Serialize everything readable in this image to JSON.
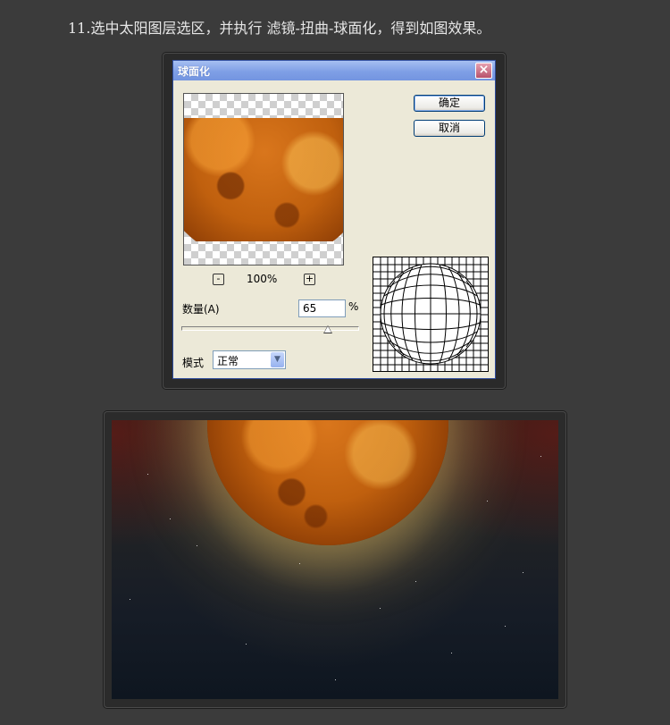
{
  "instruction": "11.选中太阳图层选区，并执行 滤镜-扭曲-球面化，得到如图效果。",
  "dialog": {
    "title": "球面化",
    "close_icon": "close-icon",
    "ok_label": "确定",
    "cancel_label": "取消",
    "zoom": {
      "minus": "-",
      "value": "100%",
      "plus": "+"
    },
    "amount": {
      "label": "数量(A)",
      "value": "65",
      "unit": "%",
      "slider_fraction": 0.825
    },
    "mode": {
      "label": "模式",
      "value": "正常"
    }
  }
}
